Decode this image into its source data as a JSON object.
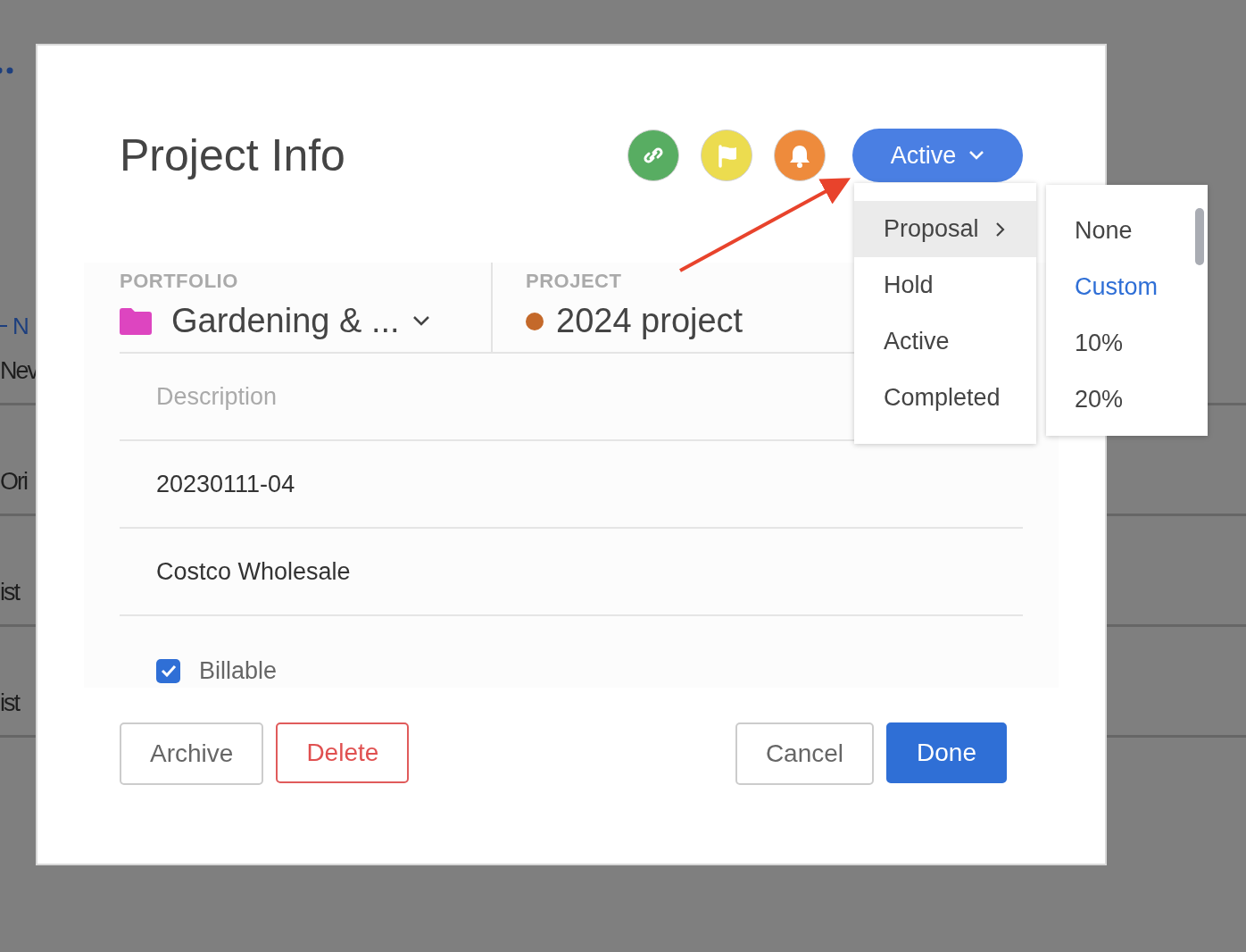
{
  "background": {
    "link": "N",
    "rows": [
      {
        "text": "Nev"
      },
      {
        "text": "Ori"
      },
      {
        "text": "ist"
      },
      {
        "text": "ist"
      }
    ]
  },
  "dialog": {
    "title": "Project Info",
    "icon_buttons": [
      {
        "kind": "link",
        "color": "#58ad62"
      },
      {
        "kind": "flag",
        "color": "#ecdc4f"
      },
      {
        "kind": "bell",
        "color": "#ee8b3c"
      }
    ],
    "status_button": {
      "label": "Active"
    },
    "status_menu": [
      {
        "label": "Proposal",
        "selected": true,
        "submenu": true
      },
      {
        "label": "Hold",
        "selected": false,
        "submenu": false
      },
      {
        "label": "Active",
        "selected": false,
        "submenu": false
      },
      {
        "label": "Completed",
        "selected": false,
        "submenu": false
      }
    ],
    "submenu": [
      {
        "label": "None",
        "selected": false
      },
      {
        "label": "Custom",
        "selected": true
      },
      {
        "label": "10%",
        "selected": false
      },
      {
        "label": "20%",
        "selected": false
      }
    ],
    "portfolio": {
      "label": "PORTFOLIO",
      "value": "Gardening & ...",
      "color": "#dd45c0"
    },
    "project": {
      "label": "PROJECT",
      "value": "2024 project",
      "color": "#c4692a"
    },
    "description": {
      "placeholder": "Description"
    },
    "fields": [
      {
        "value": "20230111-04"
      },
      {
        "value": "Costco Wholesale"
      }
    ],
    "billable": {
      "label": "Billable",
      "checked": true
    },
    "buttons": [
      {
        "label": "Archive",
        "kind": "outline"
      },
      {
        "label": "Delete",
        "kind": "danger"
      },
      {
        "label": "Cancel",
        "kind": "outline"
      },
      {
        "label": "Done",
        "kind": "primary"
      }
    ]
  }
}
